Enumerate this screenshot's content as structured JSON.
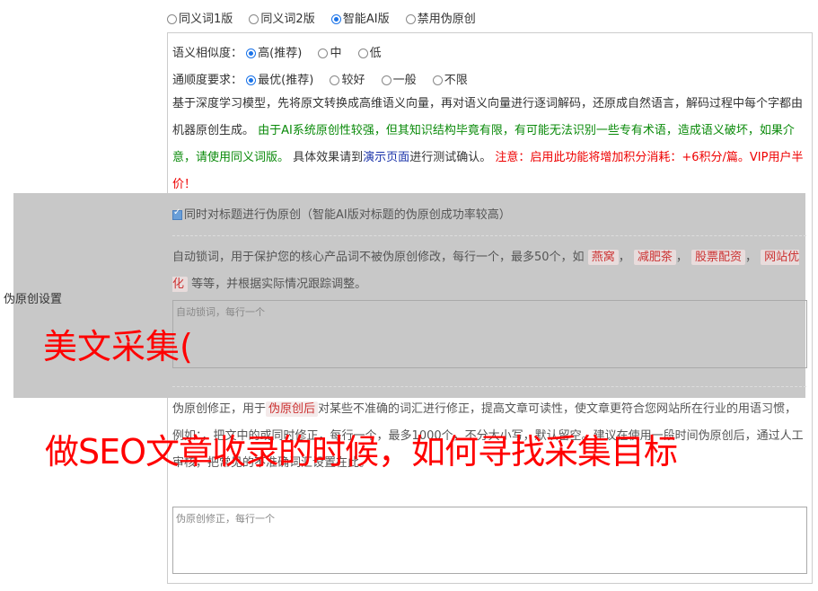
{
  "version_options": [
    {
      "label": "同义词1版",
      "selected": false
    },
    {
      "label": "同义词2版",
      "selected": false
    },
    {
      "label": "智能AI版",
      "selected": true
    },
    {
      "label": "禁用伪原创",
      "selected": false
    }
  ],
  "similarity": {
    "label": "语义相似度：",
    "options": [
      {
        "label": "高(推荐)",
        "selected": true
      },
      {
        "label": "中",
        "selected": false
      },
      {
        "label": "低",
        "selected": false
      }
    ]
  },
  "fluency": {
    "label": "通顺度要求：",
    "options": [
      {
        "label": "最优(推荐)",
        "selected": true
      },
      {
        "label": "较好",
        "selected": false
      },
      {
        "label": "一般",
        "selected": false
      },
      {
        "label": "不限",
        "selected": false
      }
    ]
  },
  "description": {
    "part1": "基于深度学习模型，先将原文转换成高维语义向量，再对语义向量进行逐词解码，还原成自然语言，解码过程中每个字都由机器原创生成。",
    "part2": "由于AI系统原创性较强，但其知识结构毕竟有限，有可能无法识别一些专有术语，造成语义破坏，如果介意，请使用同义词版。",
    "part3": "具体效果请到",
    "link": "演示页面",
    "part4": "进行测试确认。",
    "warning": "注意：启用此功能将增加积分消耗：+6积分/篇。VIP用户半价！"
  },
  "title_option": {
    "label": "同时对标题进行伪原创（智能AI版对标题的伪原创成功率较高）",
    "checked": true
  },
  "section_label": "伪原创设置",
  "lock_words": {
    "text1": "自动锁词，用于保护您的核心产品词不被伪原创修改，每行一个，最多50个，如",
    "tags": [
      "燕窝",
      "减肥茶",
      "股票配资",
      "网站优化"
    ],
    "text2": "等等，并根据实际情况跟踪调整。",
    "placeholder": "自动锁词，每行一个"
  },
  "correction": {
    "text1": "伪原创修正，用于",
    "tag": "伪原创后",
    "text2": "对某些不准确的词汇进行修正，提高文章可读性，使文章更符合您网站所在行业的用语习惯，例如：",
    "text3": "，把文中的",
    "text4": "或",
    "text5": "同时修正，每行一个，最多1000个，不分大小写，默认留空。建议在使用一段时间伪原创后，通过人工审核，把常见的不准确词汇设置在此。",
    "placeholder": "伪原创修正，每行一个"
  },
  "overlay_title_1": "美文采集(",
  "overlay_title_2": "做SEO文章收录的时候，如何寻找采集目标"
}
